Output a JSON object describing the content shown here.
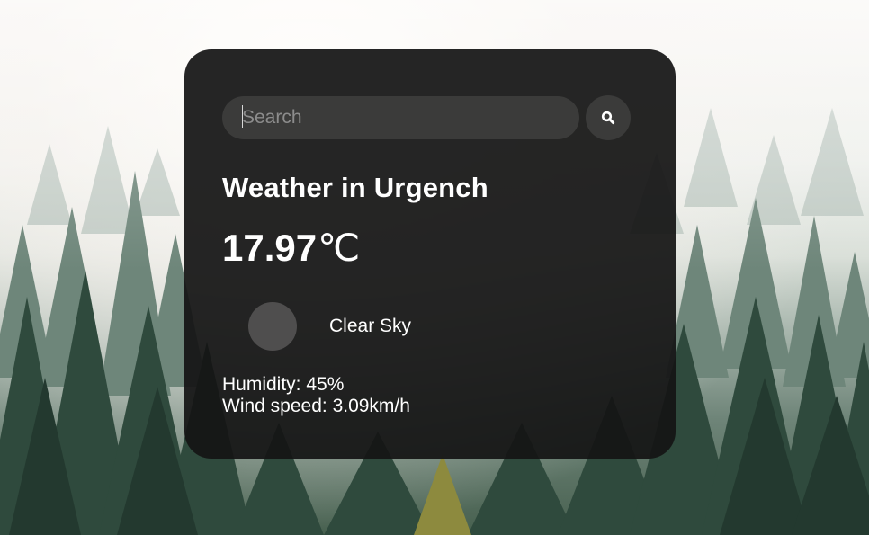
{
  "search": {
    "placeholder": "Search",
    "value": "",
    "button_icon": "search-icon"
  },
  "weather": {
    "title": "Weather in Urgench",
    "temperature": "17.97",
    "unit": "℃",
    "icon": "weather-condition-icon",
    "description": "Clear Sky",
    "humidity": "Humidity: 45%",
    "wind": "Wind speed: 3.09km/h"
  },
  "colors": {
    "card_background": "#141414",
    "input_background": "#3b3b3a",
    "text": "#ffffff",
    "placeholder": "#8c8c8c"
  }
}
